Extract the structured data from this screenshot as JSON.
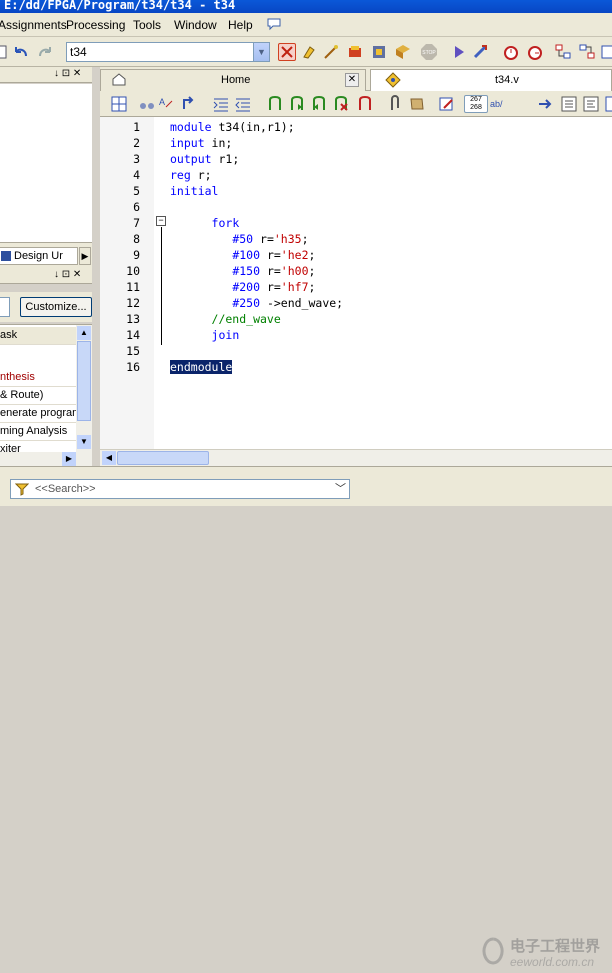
{
  "window": {
    "title": "E:/dd/FPGA/Program/t34/t34 - t34"
  },
  "menu": {
    "items": [
      "Assignments",
      "Processing",
      "Tools",
      "Window",
      "Help"
    ],
    "underline": [
      "A",
      "P",
      "T",
      "W",
      "H"
    ]
  },
  "toolbar": {
    "project_combo": "t34"
  },
  "left_panes": {
    "top_controls": "↓ ⊡ ✕",
    "design_tab_label": "Design Ur",
    "mid_controls": "↓ ⊡ ✕",
    "customize_label": "Customize...",
    "tasks_header": "ask",
    "tasks": [
      "nthesis",
      "& Route)",
      "enerate program",
      "ming Analysis",
      "xiter"
    ]
  },
  "tabs": [
    {
      "label": "Home"
    },
    {
      "label": "t34.v"
    }
  ],
  "editor": {
    "line_numbers": [
      "1",
      "2",
      "3",
      "4",
      "5",
      "6",
      "7",
      "8",
      "9",
      "10",
      "11",
      "12",
      "13",
      "14",
      "15",
      "16"
    ],
    "lines": [
      {
        "text": "module t34(in,r1);"
      },
      {
        "text": "input in;"
      },
      {
        "text": "output r1;"
      },
      {
        "text": "reg r;"
      },
      {
        "text": "initial"
      },
      {
        "text": ""
      },
      {
        "text": "      fork"
      },
      {
        "text": "         #50 r='h35;"
      },
      {
        "text": "         #100 r='he2;"
      },
      {
        "text": "         #150 r='h00;"
      },
      {
        "text": "         #200 r='hf7;"
      },
      {
        "text": "         #250 ->end_wave;"
      },
      {
        "text": "      //end_wave"
      },
      {
        "text": "      join"
      },
      {
        "text": ""
      },
      {
        "text": "endmodule"
      }
    ]
  },
  "search": {
    "placeholder": "<<Search>>"
  },
  "watermark": {
    "line1": "电子工程世界",
    "line2": "eeworld.com.cn"
  },
  "colors": {
    "keyword": "#0000ff",
    "number": "#c00000",
    "comment": "#008000",
    "selection": "#0a246a"
  }
}
